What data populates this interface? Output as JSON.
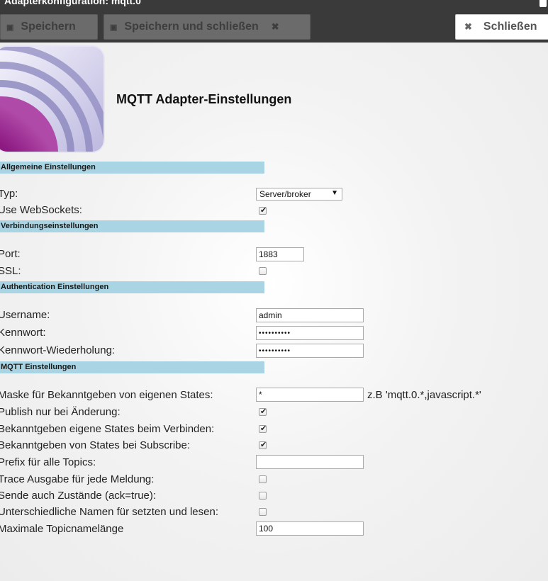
{
  "window": {
    "title": "Adapterkonfiguration: mqtt.0"
  },
  "toolbar": {
    "save_label": "Speichern",
    "save_close_label": "Speichern und schließen",
    "close_label": "Schließen"
  },
  "heading": "MQTT Adapter-Einstellungen",
  "sections": {
    "general": "Allgemeine Einstellungen",
    "connection": "Verbindungseinstellungen",
    "auth": "Authentication Einstellungen",
    "mqtt": "MQTT Einstellungen"
  },
  "fields": {
    "type": {
      "label": "Typ:",
      "value": "Server/broker"
    },
    "websockets": {
      "label": "Use WebSockets:",
      "checked": true
    },
    "port": {
      "label": "Port:",
      "value": "1883"
    },
    "ssl": {
      "label": "SSL:",
      "checked": false
    },
    "username": {
      "label": "Username:",
      "value": "admin"
    },
    "password": {
      "label": "Kennwort:",
      "value": "••••••••••"
    },
    "password_repeat": {
      "label": "Kennwort-Wiederholung:",
      "value": "••••••••••"
    },
    "mask": {
      "label": "Maske für Bekanntgeben von eigenen States:",
      "value": "*",
      "hint": "z.B 'mqtt.0.*,javascript.*'"
    },
    "publish_on_change": {
      "label": "Publish nur bei Änderung:",
      "checked": true
    },
    "publish_on_connect": {
      "label": "Bekanntgeben eigene States beim Verbinden:",
      "checked": true
    },
    "publish_on_subscribe": {
      "label": "Bekanntgeben von States bei Subscribe:",
      "checked": true
    },
    "prefix": {
      "label": "Prefix für alle Topics:",
      "value": ""
    },
    "trace": {
      "label": "Trace Ausgabe für jede Meldung:",
      "checked": false
    },
    "send_ack": {
      "label": "Sende auch Zustände (ack=true):",
      "checked": false
    },
    "different_names": {
      "label": "Unterschiedliche Namen für setzten und lesen:",
      "checked": false
    },
    "max_topic_length": {
      "label": "Maximale Topicnamelänge",
      "value": "100"
    }
  },
  "colors": {
    "toolbar_bg": "#3a3a3a",
    "section_bg": "#a8d4e3",
    "logo_purple": "#8a1a7a"
  }
}
